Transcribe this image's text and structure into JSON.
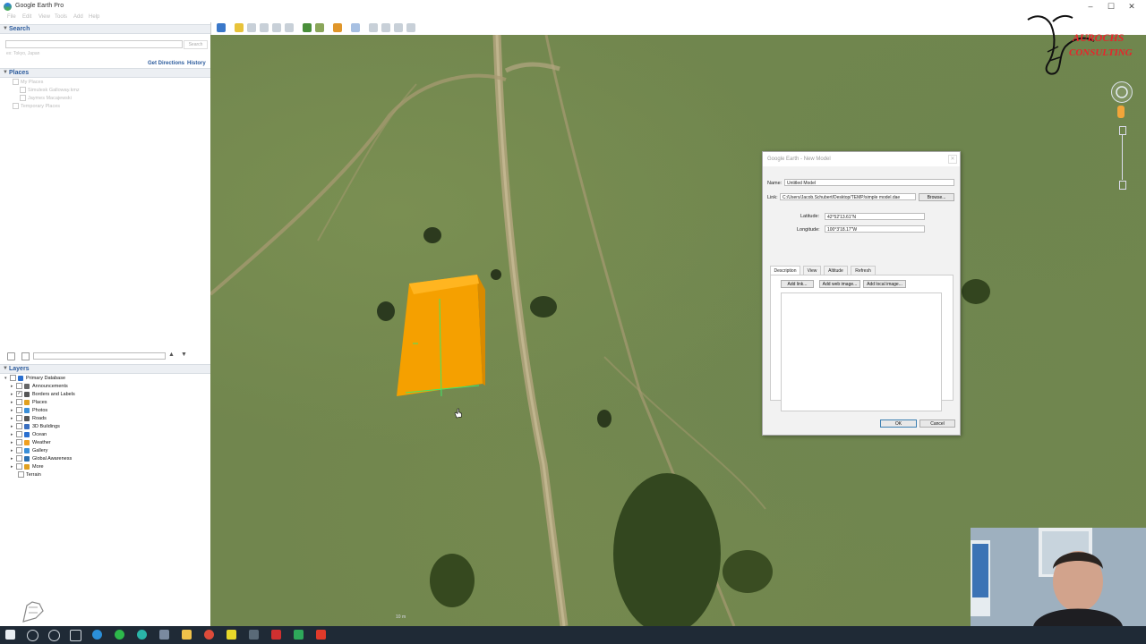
{
  "window": {
    "title": "Google Earth Pro",
    "controls": [
      "–",
      "☐",
      "✕"
    ]
  },
  "menu": [
    "File",
    "Edit",
    "View",
    "Tools",
    "Add",
    "Help"
  ],
  "search": {
    "header": "Search",
    "input_value": "",
    "button_label": "Search",
    "hint": "ex: Tokyo, Japan",
    "get_directions": "Get Directions",
    "history": "History"
  },
  "places": {
    "header": "Places",
    "items": [
      "My Places",
      "Simulesk Galloway.kmz",
      "Jaymes Macajewski",
      "Temporary Places"
    ]
  },
  "layers": {
    "header": "Layers",
    "root": "Primary Database",
    "items": [
      {
        "label": "Announcements",
        "checked": false,
        "icon_color": "#666666"
      },
      {
        "label": "Borders and Labels",
        "checked": true,
        "icon_color": "#555555"
      },
      {
        "label": "Places",
        "checked": false,
        "icon_color": "#e0a020"
      },
      {
        "label": "Photos",
        "checked": false,
        "icon_color": "#3a8fd8"
      },
      {
        "label": "Roads",
        "checked": false,
        "icon_color": "#555555"
      },
      {
        "label": "3D Buildings",
        "checked": false,
        "icon_color": "#3a6fc0"
      },
      {
        "label": "Ocean",
        "checked": false,
        "icon_color": "#2a6fd0"
      },
      {
        "label": "Weather",
        "checked": false,
        "icon_color": "#f0a020"
      },
      {
        "label": "Gallery",
        "checked": false,
        "icon_color": "#3a8fd8"
      },
      {
        "label": "Global Awareness",
        "checked": false,
        "icon_color": "#2a6fb0"
      },
      {
        "label": "More",
        "checked": false,
        "icon_color": "#e0a020"
      }
    ],
    "terrain": "Terrain"
  },
  "logo": {
    "text_line1": "AUROCHS",
    "text_line2": "CONSULTING",
    "color": "#e8242b"
  },
  "map": {
    "scale_label": "10 m",
    "model_color": "#f5a000"
  },
  "dialog": {
    "title": "Google Earth - New Model",
    "name_label": "Name:",
    "name_value": "Untitled Model",
    "link_label": "Link:",
    "link_value": "C:/Users/Jacob.Schubert/Desktop/TEMP/simple model.dae",
    "browse": "Browse...",
    "latitude_label": "Latitude:",
    "latitude_value": "42°52'13.61\"N",
    "longitude_label": "Longitude:",
    "longitude_value": "100°3'18.17\"W",
    "tabs": [
      "Description",
      "View",
      "Altitude",
      "Refresh"
    ],
    "active_tab": "Description",
    "add_link": "Add link...",
    "add_web_image": "Add web image...",
    "add_local_image": "Add local image...",
    "ok": "OK",
    "cancel": "Cancel"
  }
}
